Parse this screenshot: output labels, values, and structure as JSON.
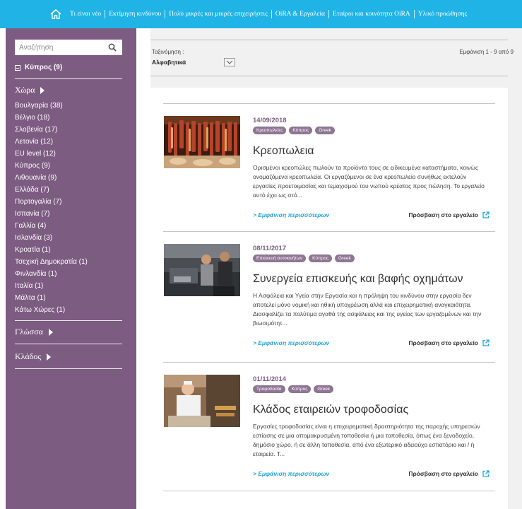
{
  "topnav": {
    "items": [
      "Τι είναι νέο",
      "Εκτίμηση κινδύνου",
      "Πολύ μικρές και μικρές επιχειρήσεις",
      "OiRA & Εργαλεία",
      "Εταίροι και κοινότητα OiRA",
      "Υλικό προώθησης"
    ]
  },
  "sidebar": {
    "search_placeholder": "Αναζήτηση",
    "active_filter": "Κύπρος (9)",
    "country_heading": "Χώρα",
    "countries": [
      "Βουλγαρία (38)",
      "Βέλγιο (18)",
      "Σλοβενία (17)",
      "Λετονία (12)",
      "EU level (12)",
      "Κύπρος (9)",
      "Λιθουανία (9)",
      "Ελλάδα (7)",
      "Πορτογαλία (7)",
      "Ισπανία (7)",
      "Γαλλία (4)",
      "Ισλανδία (3)",
      "Κροατία (1)",
      "Τσεχική Δημοκρατία (1)",
      "Φινλανδία (1)",
      "Ιταλία (1)",
      "Μάλτα (1)",
      "Κάτω Χώρες (1)"
    ],
    "language_heading": "Γλώσσα",
    "sector_heading": "Κλάδος"
  },
  "main": {
    "sort_label": "Ταξινόμηση :",
    "sort_value": "Αλφαβητικά",
    "results_count": "Εμφάνιση 1 - 9 από 9",
    "more_label": "> Εμφάνιση περισσότερων",
    "access_label": "Πρόσβαση στο εργαλείο",
    "cards": [
      {
        "date": "14/09/2018",
        "tags": [
          "Κρεοπωλείες",
          "Κύπρος",
          "Greek"
        ],
        "title": "Κρεοπωλεια",
        "description": "Ορισμένοι κρεοπώλες πωλούν τα προϊόντα τους σε ειδικευμένα καταστήματα, κοινώς ονομαζόμενα κρεοπωλεία. Οι εργαζόμενοι σε ένα κρεοπωλείο συνήθως εκτελούν εργασίες προετοιμασίας και τεμαχισμού του νωπού κρέατος προς πώληση. Το εργαλείο αυτό έχει ως στό..."
      },
      {
        "date": "08/11/2017",
        "tags": [
          "Επισκευή αυτοκινήτων",
          "Κύπρος",
          "Greek"
        ],
        "title": "Συνεργεία επισκευής και βαφής οχημάτων",
        "description": "Η Ασφάλεια και Υγεία στην Εργασία και η πρόληψη του κινδύνου στην εργασία δεν αποτελεί μόνο νομική και ηθική υποχρέωση αλλά και επιχειρηματική αναγκαιότητα. Διασφαλίζει τα πολύτιμα αγαθά της ασφάλειας και της υγείας των εργαζομένων και την βιωσιμότητ..."
      },
      {
        "date": "01/11/2014",
        "tags": [
          "Τροφοδοσία",
          "Κύπρος",
          "Greek"
        ],
        "title": "Κλάδος εταιρειών τροφοδοσίας",
        "description": "Εργασίες τροφοδοσίας είναι η επιχειρηματική δραστηριότητα της παροχής υπηρεσιών εστίασης σε μια απομακρυσμένη τοποθεσία ή μια τοποθεσία, όπως ένα ξενοδοχείο, δημόσιο χώρο, ή σε άλλη τοποθεσία, από ένα εξωτερικό αδειούχο εστιατόριο και / ή εταιρεία. Τ..."
      }
    ]
  },
  "colors": {
    "topnav_bg": "#20b3e6",
    "sidebar_bg": "#7d5c82",
    "accent_link": "#20a6d8",
    "date_color": "#7d5c82",
    "tag_bg": "#8e7593"
  },
  "icons": {
    "home": "home-icon",
    "search": "search-icon",
    "sort": "chevron-down-icon",
    "external": "external-link-icon"
  }
}
